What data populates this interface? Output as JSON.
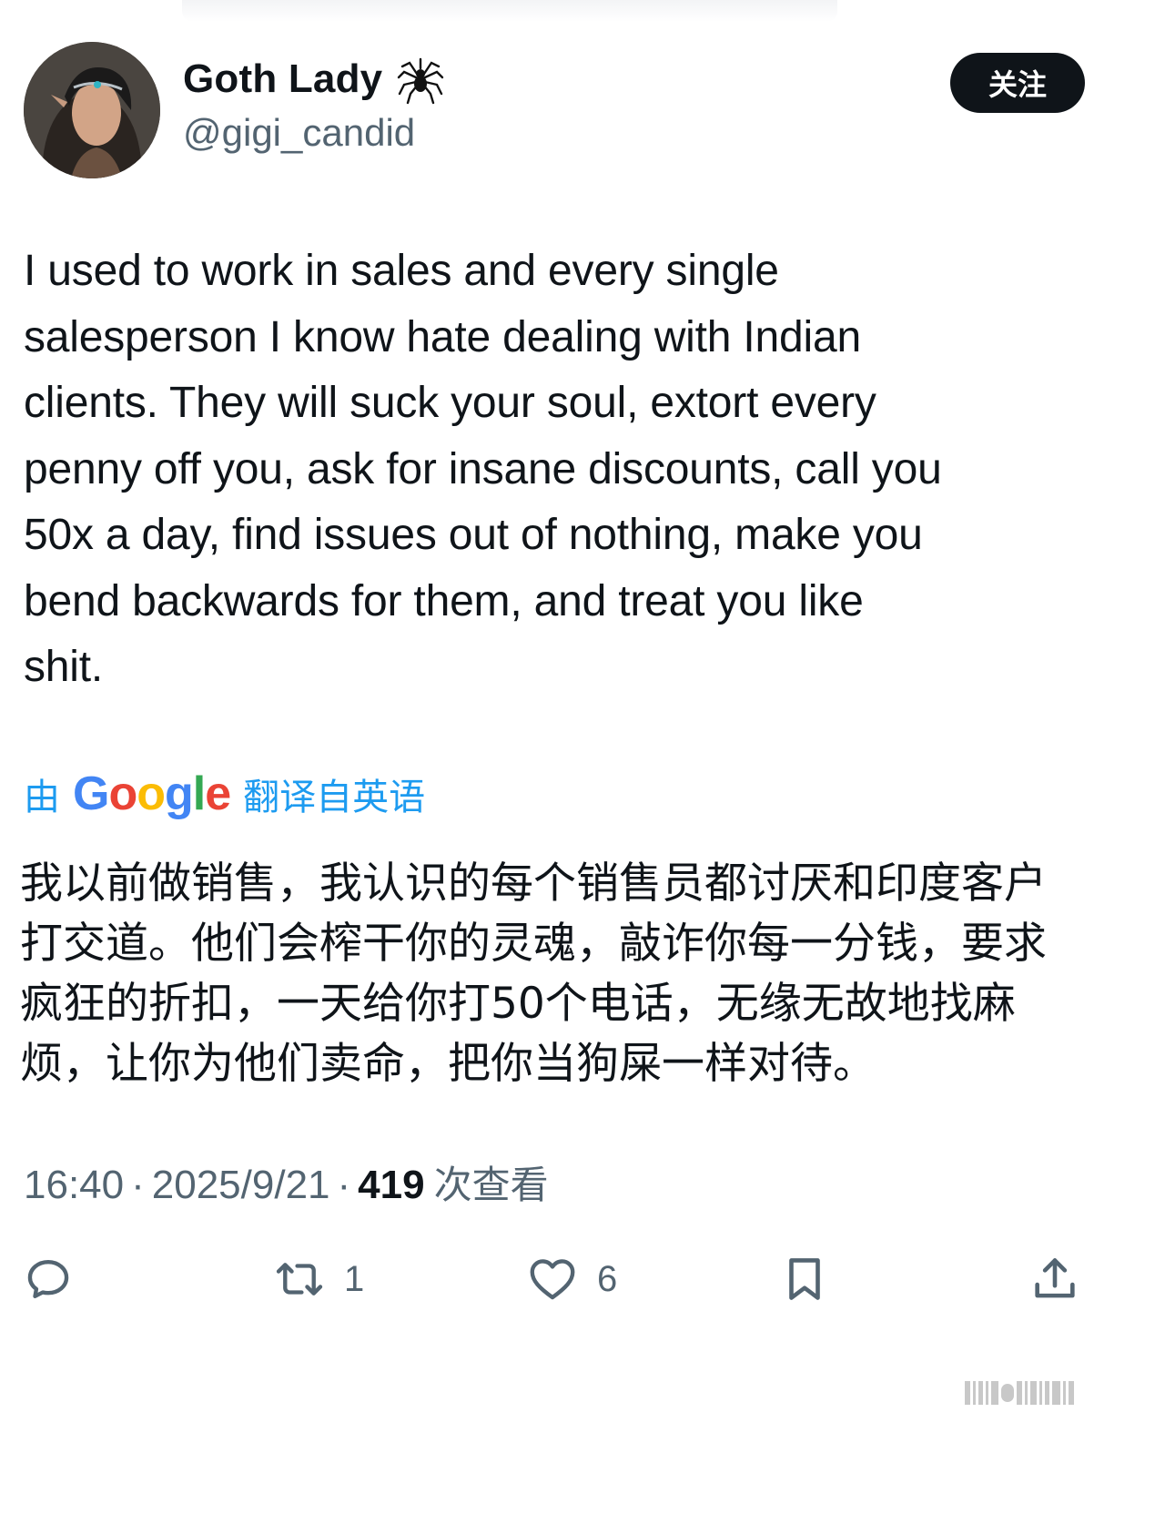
{
  "author": {
    "display_name": "Goth Lady",
    "handle": "@gigi_candid",
    "badge_icon": "spider-icon",
    "follow_label": "关注"
  },
  "tweet": {
    "lines": [
      "I used to work in sales and every single",
      "salesperson I know hate dealing with Indian",
      "clients. They will suck your soul, extort every",
      "penny off you, ask for insane discounts, call you",
      "50x a day, find issues out of nothing, make you",
      "bend backwards for them, and treat you like",
      "shit."
    ]
  },
  "translation": {
    "prefix": "由",
    "provider_letters": [
      "G",
      "o",
      "o",
      "g",
      "l",
      "e"
    ],
    "suffix": "翻译自英语",
    "lines": [
      "我以前做销售，我认识的每个销售员都讨厌和印度客户",
      "打交道。他们会榨干你的灵魂，敲诈你每一分钱，要求",
      "疯狂的折扣，一天给你打50个电话，无缘无故地找麻",
      "烦，让你为他们卖命，把你当狗屎一样对待。"
    ]
  },
  "meta": {
    "time": "16:40",
    "separator": "·",
    "date": "2025/9/21",
    "views_count": "419",
    "views_label": "次查看"
  },
  "actions": {
    "reply_icon": "reply-icon",
    "retweet_icon": "retweet-icon",
    "retweet_count": "1",
    "like_icon": "heart-icon",
    "like_count": "6",
    "bookmark_icon": "bookmark-icon",
    "share_icon": "share-icon"
  },
  "colors": {
    "text": "#0f1419",
    "secondary": "#536471",
    "link": "#1d9bf0",
    "button_bg": "#0f1419",
    "google_blue": "#4285f4",
    "google_red": "#ea4335",
    "google_yellow": "#fbbc05",
    "google_green": "#34a853"
  }
}
